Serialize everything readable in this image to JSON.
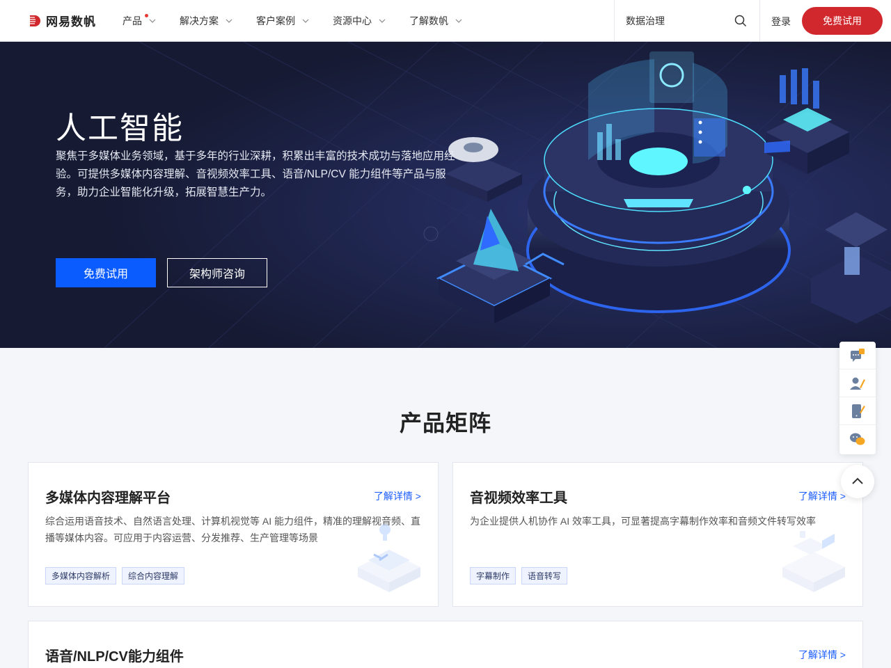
{
  "header": {
    "logo_text": "网易数帆",
    "nav": [
      {
        "label": "产品",
        "has_dot": true
      },
      {
        "label": "解决方案"
      },
      {
        "label": "客户案例"
      },
      {
        "label": "资源中心"
      },
      {
        "label": "了解数帆"
      }
    ],
    "search_text": "数据治理",
    "login_label": "登录",
    "try_label": "免费试用"
  },
  "hero": {
    "title": "人工智能",
    "description": "聚焦于多媒体业务领域，基于多年的行业深耕，积累出丰富的技术成功与落地应用经验。可提供多媒体内容理解、音视频效率工具、语音/NLP/CV 能力组件等产品与服务，助力企业智能化升级，拓展智慧生产力。",
    "primary_button": "免费试用",
    "secondary_button": "架构师咨询"
  },
  "products": {
    "section_title": "产品矩阵",
    "cards": [
      {
        "title": "多媒体内容理解平台",
        "link": "了解详情 >",
        "desc_line1": "综合运用语音技术、自然语言处理、计算机视觉等 AI 能力组件，精准的理解视音频、直",
        "desc_line2": "播等媒体内容。可应用于内容运营、分发推荐、生产管理等场景",
        "tags": [
          "多媒体内容解析",
          "综合内容理解"
        ]
      },
      {
        "title": "音视频效率工具",
        "link": "了解详情 >",
        "desc_line1": "为企业提供人机协作 AI 效率工具，可显著提高字幕制作效率和音频文件转写效率",
        "desc_line2": "",
        "tags": [
          "字幕制作",
          "语音转写"
        ]
      },
      {
        "title": "语音/NLP/CV能力组件",
        "link": "了解详情 >"
      }
    ]
  },
  "float_bar": {
    "icons": [
      "chat-icon",
      "consultant-icon",
      "phone-icon",
      "wechat-icon"
    ]
  },
  "colors": {
    "brand_red": "#d1282e",
    "primary_blue": "#0b5cff",
    "hero_bg": "#161a33",
    "link_blue": "#1a5cff"
  }
}
